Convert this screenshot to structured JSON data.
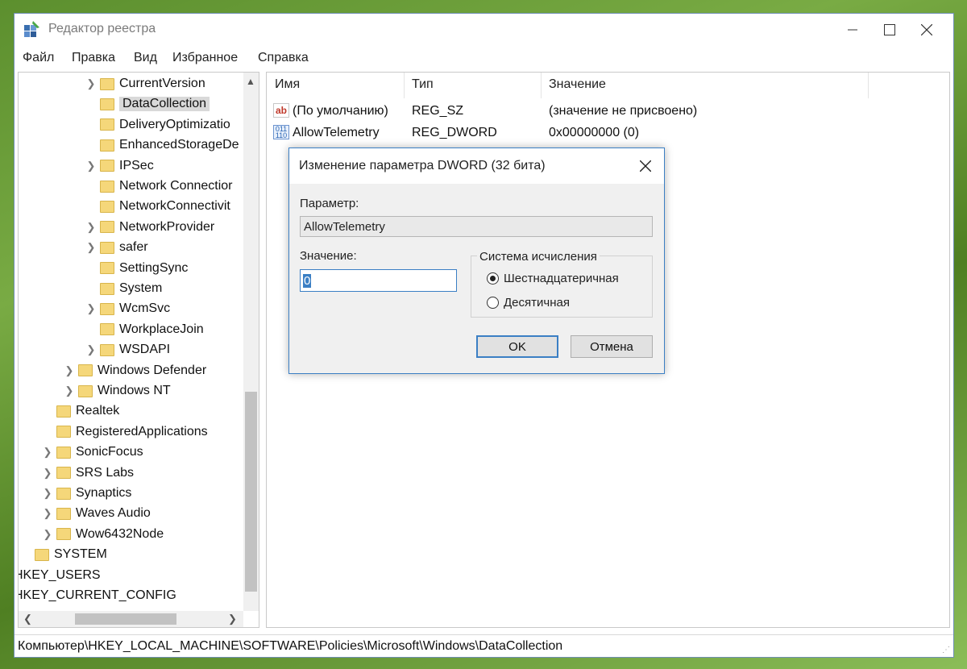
{
  "window": {
    "title": "Редактор реестра",
    "controls": {
      "minimize": "minimize",
      "maximize": "maximize",
      "close": "close"
    }
  },
  "menu": [
    "Файл",
    "Правка",
    "Вид",
    "Избранное",
    "Справка"
  ],
  "tree": [
    {
      "label": "CurrentVersion",
      "indent": 3,
      "expandable": true,
      "selected": false
    },
    {
      "label": "DataCollection",
      "indent": 3,
      "expandable": false,
      "selected": true
    },
    {
      "label": "DeliveryOptimizatio",
      "indent": 3,
      "expandable": false,
      "selected": false
    },
    {
      "label": "EnhancedStorageDe",
      "indent": 3,
      "expandable": false,
      "selected": false
    },
    {
      "label": "IPSec",
      "indent": 3,
      "expandable": true,
      "selected": false
    },
    {
      "label": "Network Connectior",
      "indent": 3,
      "expandable": false,
      "selected": false
    },
    {
      "label": "NetworkConnectivit",
      "indent": 3,
      "expandable": false,
      "selected": false
    },
    {
      "label": "NetworkProvider",
      "indent": 3,
      "expandable": true,
      "selected": false
    },
    {
      "label": "safer",
      "indent": 3,
      "expandable": true,
      "selected": false
    },
    {
      "label": "SettingSync",
      "indent": 3,
      "expandable": false,
      "selected": false
    },
    {
      "label": "System",
      "indent": 3,
      "expandable": false,
      "selected": false
    },
    {
      "label": "WcmSvc",
      "indent": 3,
      "expandable": true,
      "selected": false
    },
    {
      "label": "WorkplaceJoin",
      "indent": 3,
      "expandable": false,
      "selected": false
    },
    {
      "label": "WSDAPI",
      "indent": 3,
      "expandable": true,
      "selected": false
    },
    {
      "label": "Windows Defender",
      "indent": 2,
      "expandable": true,
      "selected": false
    },
    {
      "label": "Windows NT",
      "indent": 2,
      "expandable": true,
      "selected": false
    },
    {
      "label": "Realtek",
      "indent": 1,
      "expandable": false,
      "selected": false
    },
    {
      "label": "RegisteredApplications",
      "indent": 1,
      "expandable": false,
      "selected": false
    },
    {
      "label": "SonicFocus",
      "indent": 1,
      "expandable": true,
      "selected": false
    },
    {
      "label": "SRS Labs",
      "indent": 1,
      "expandable": true,
      "selected": false
    },
    {
      "label": "Synaptics",
      "indent": 1,
      "expandable": true,
      "selected": false
    },
    {
      "label": "Waves Audio",
      "indent": 1,
      "expandable": true,
      "selected": false
    },
    {
      "label": "Wow6432Node",
      "indent": 1,
      "expandable": true,
      "selected": false
    },
    {
      "label": "SYSTEM",
      "indent": 0,
      "expandable": false,
      "selected": false
    },
    {
      "label": "HKEY_USERS",
      "indent": -1,
      "expandable": false,
      "selected": false
    },
    {
      "label": "HKEY_CURRENT_CONFIG",
      "indent": -1,
      "expandable": false,
      "selected": false
    }
  ],
  "list": {
    "columns": [
      "Имя",
      "Тип",
      "Значение"
    ],
    "rows": [
      {
        "icon": "string-value-icon",
        "icon_glyph": "ab",
        "name": "(По умолчанию)",
        "type": "REG_SZ",
        "value": "(значение не присвоено)"
      },
      {
        "icon": "binary-value-icon",
        "icon_glyph": "011 110",
        "name": "AllowTelemetry",
        "type": "REG_DWORD",
        "value": "0x00000000 (0)"
      }
    ]
  },
  "status": {
    "path": "Компьютер\\HKEY_LOCAL_MACHINE\\SOFTWARE\\Policies\\Microsoft\\Windows\\DataCollection"
  },
  "dialog": {
    "title": "Изменение параметра DWORD (32 бита)",
    "param_label": "Параметр:",
    "param_value": "AllowTelemetry",
    "value_label": "Значение:",
    "value": "0",
    "base_group_label": "Система исчисления",
    "base_options": [
      {
        "label": "Шестнадцатеричная",
        "checked": true
      },
      {
        "label": "Десятичная",
        "checked": false
      }
    ],
    "ok_label": "OK",
    "cancel_label": "Отмена"
  }
}
